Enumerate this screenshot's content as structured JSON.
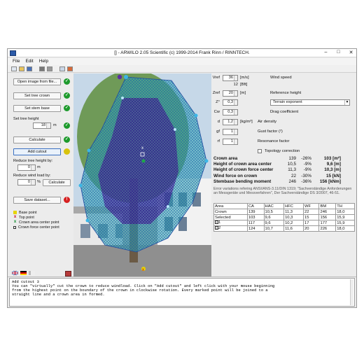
{
  "window": {
    "title": "[] - ARWILO 2.05 Scientific (c) 1999-2014 Frank Rinn / RINNTECH.",
    "min": "–",
    "max": "□",
    "close": "✕"
  },
  "menu": [
    "File",
    "Edit",
    "Help"
  ],
  "toolbar_icons": [
    "new-icon",
    "open-icon",
    "save-icon",
    "print-icon",
    "print-preview-icon",
    "copy-icon",
    "export-icon"
  ],
  "left": {
    "open_image": "Open image from file...",
    "set_crown": "Set tree crown",
    "set_base": "Set stem base",
    "tree_height_label": "Set tree height",
    "tree_height_value": "18",
    "tree_height_unit": "m",
    "calculate": "Calculate",
    "add_cutout": "Add cutout",
    "reduce_height_label": "Reduce tree height by:",
    "reduce_height_value": "0",
    "reduce_height_unit": "m",
    "reduce_wind_label": "Reduce wind load by:",
    "reduce_wind_value": "0",
    "reduce_wind_unit": "%",
    "calculate2": "Calculate",
    "save_dataset": "Save dataset...",
    "legend": [
      "Base point",
      "Top point",
      "Crown area center point",
      "Crown force center point"
    ],
    "status": [
      "ok",
      "ok",
      "ok",
      "ok",
      "ok",
      "warn",
      "err"
    ]
  },
  "params": [
    {
      "sym": "Vref",
      "val": "36",
      "unit": "[m/s]",
      "desc": "Wind speed"
    },
    {
      "sym": "",
      "val": "12",
      "unit": "[Bft]",
      "desc": ""
    },
    {
      "sym": "Zref",
      "val": "20",
      "unit": "[m]",
      "desc": "Reference height"
    },
    {
      "sym": "Z°",
      "val": "0,3",
      "unit": "",
      "desc": ""
    },
    {
      "sym": "Cw",
      "val": "0,3",
      "unit": "",
      "desc": "Drag coefficient"
    },
    {
      "sym": "d",
      "val": "1,2",
      "unit": "[kg/m³]",
      "desc": "Air density"
    },
    {
      "sym": "gf",
      "val": "1",
      "unit": "",
      "desc": "Gust factor (²)"
    },
    {
      "sym": "rf",
      "val": "1",
      "unit": "",
      "desc": "Resonance factor"
    }
  ],
  "terrain": "Terrain exponent",
  "topology": "Topology correction",
  "results": [
    {
      "name": "Crown area",
      "val": "139",
      "pct": "-26%",
      "res": "103 [m²]"
    },
    {
      "name": "Height of crown area center",
      "val": "10,5",
      "pct": "-9%",
      "res": "9,6 [m]"
    },
    {
      "name": "Height of crown force center",
      "val": "11,3",
      "pct": "-9%",
      "res": "10,3 [m]"
    },
    {
      "name": "Wind force on crown",
      "val": "22",
      "pct": "-30%",
      "res": "15 [kN]"
    },
    {
      "name": "Stembase bending moment",
      "val": "246",
      "pct": "-36%",
      "res": "156 [kNm]"
    }
  ],
  "error_note": "Error variations refering ANSI/ANS-3.11/DIN 1319; \"Sachverständige Anforderungen an Messgeräte und Messverfahren\", Der Sachverständige DS 3/2007, 46-51.",
  "table": {
    "headers": [
      "Area",
      "CA",
      "HAC",
      "HFC",
      "WF",
      "BM",
      "TH"
    ],
    "rows": [
      [
        "Crown",
        "139",
        "10,5",
        "11,3",
        "22",
        "246",
        "18,0"
      ],
      [
        "Selected",
        "103",
        "9,6",
        "10,3",
        "15",
        "156",
        "15,9"
      ],
      [
        "1",
        "117",
        "9,6",
        "10,2",
        "17",
        "177",
        "15,9"
      ],
      [
        "2",
        "124",
        "10,7",
        "11,6",
        "20",
        "226",
        "18,0"
      ]
    ]
  },
  "status_text": "Add cutout 3\nYou can \"virtually\" cut the crown to reduce windload. Click on \"Add cutout\" and left click with your mouse beginning\nfrom the highest point on the boundary of the crown in clockwise rotation. Every marked point will be joined to a\nstraight line and a crown area in formed."
}
